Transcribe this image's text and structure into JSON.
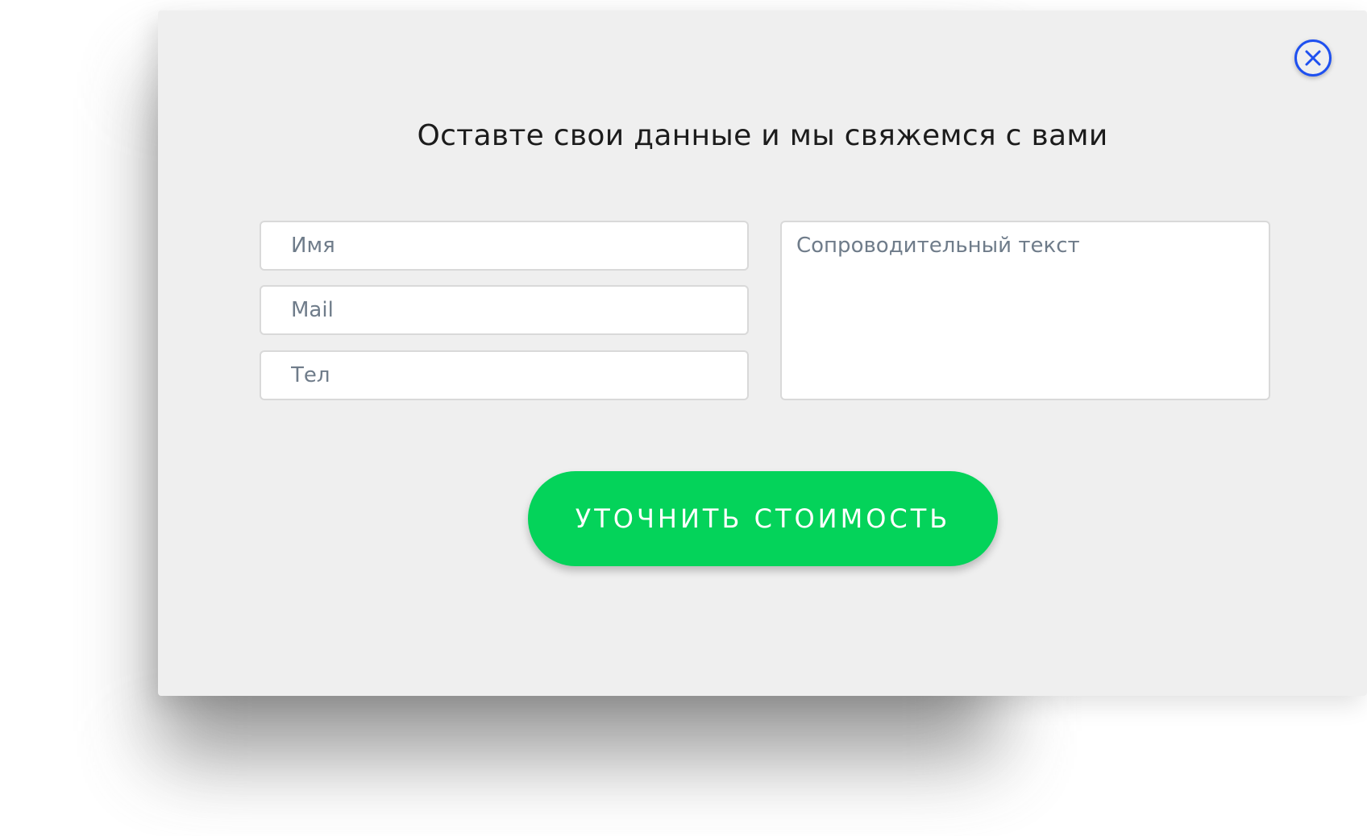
{
  "modal": {
    "title": "Оставте свои данные и мы свяжемся с вами",
    "close_icon": "close-x-circle-icon",
    "fields": {
      "name_placeholder": "Имя",
      "mail_placeholder": "Mail",
      "phone_placeholder": "Тел",
      "message_placeholder": "Сопроводительный текст"
    },
    "submit_label": "УТОЧНИТЬ СТОИМОСТЬ"
  },
  "colors": {
    "accent_green": "#04d35a",
    "close_blue": "#1e50f0",
    "modal_background": "#efefef"
  }
}
